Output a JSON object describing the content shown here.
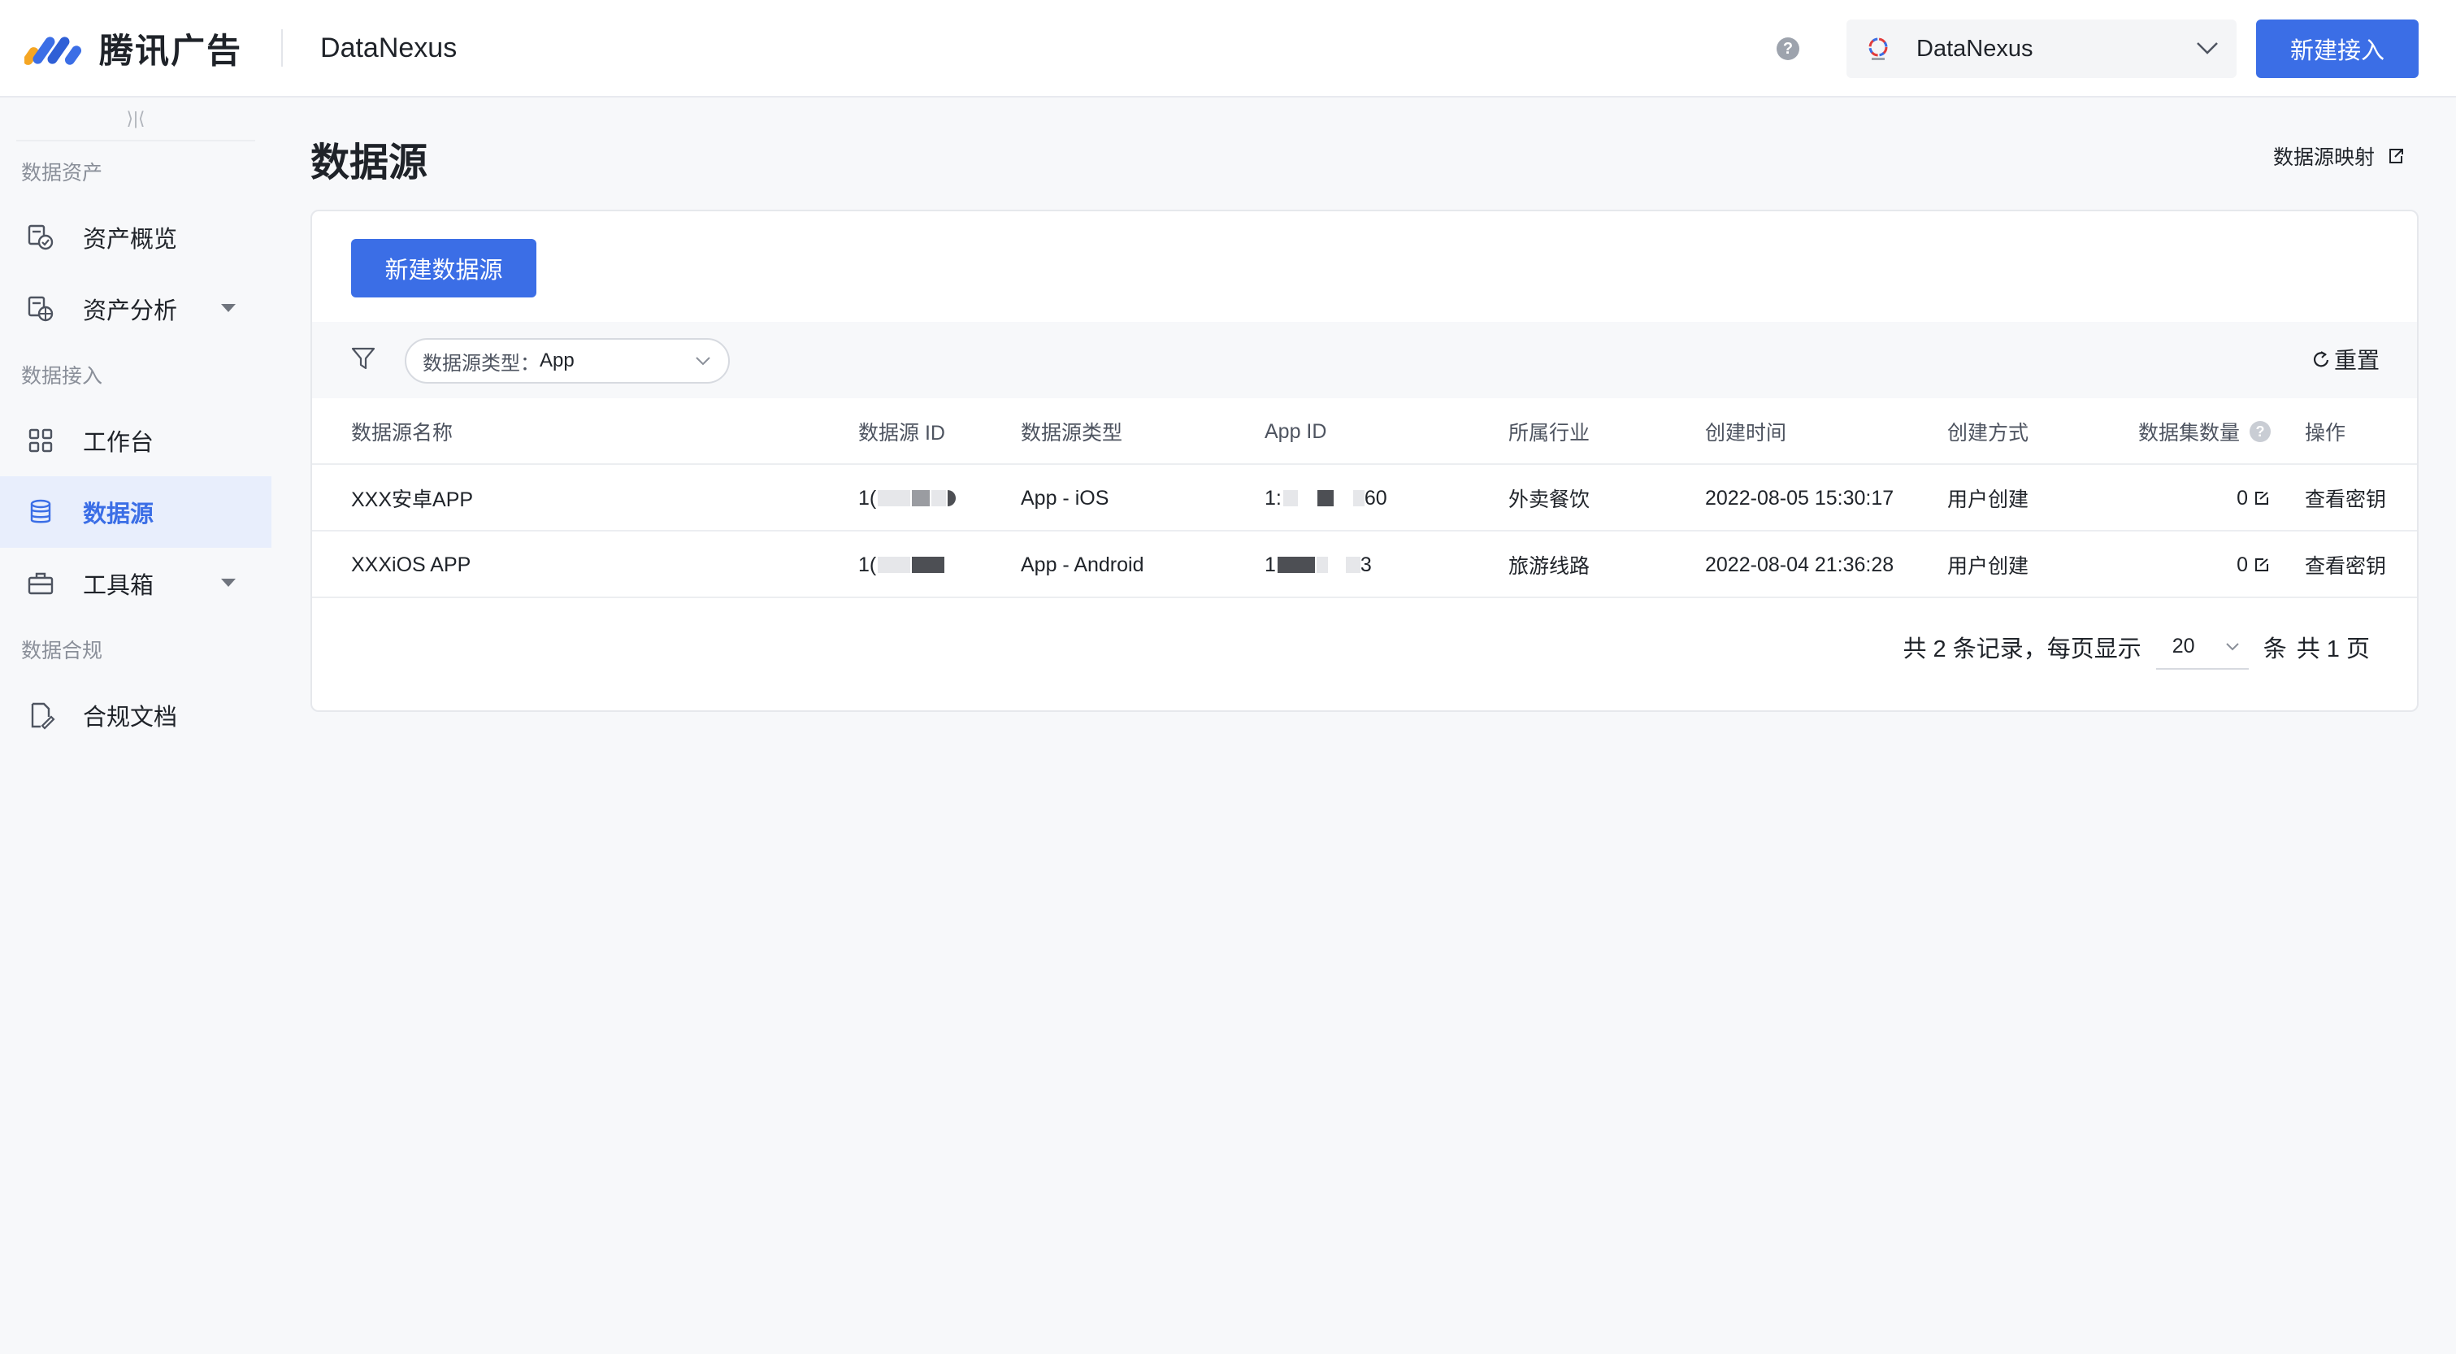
{
  "header": {
    "brand": "腾讯广告",
    "product": "DataNexus",
    "help_icon": "?",
    "account": "DataNexus",
    "new_access_label": "新建接入"
  },
  "sidebar": {
    "collapse_glyph": "⟩|⟨",
    "groups": [
      {
        "title": "数据资产"
      },
      {
        "title": "数据接入"
      },
      {
        "title": "数据合规"
      }
    ],
    "items": [
      {
        "label": "资产概览",
        "icon": "overview-icon"
      },
      {
        "label": "资产分析",
        "icon": "analysis-icon",
        "expandable": true
      },
      {
        "label": "工作台",
        "icon": "grid-icon"
      },
      {
        "label": "数据源",
        "icon": "database-icon",
        "active": true
      },
      {
        "label": "工具箱",
        "icon": "toolbox-icon",
        "expandable": true
      },
      {
        "label": "合规文档",
        "icon": "document-icon"
      }
    ]
  },
  "main": {
    "title": "数据源",
    "mapping_link": "数据源映射",
    "new_datasource_label": "新建数据源",
    "filter": {
      "label": "数据源类型：",
      "value": "App"
    },
    "reset_label": "重置",
    "table": {
      "columns": [
        "数据源名称",
        "数据源 ID",
        "数据源类型",
        "App ID",
        "所属行业",
        "创建时间",
        "创建方式",
        "数据集数量",
        "操作"
      ],
      "rows": [
        {
          "name": "XXX安卓APP",
          "id_prefix": "1(",
          "type": "App - iOS",
          "app_id_prefix": "1:",
          "app_id_suffix": "60",
          "industry": "外卖餐饮",
          "created": "2022-08-05 15:30:17",
          "method": "用户创建",
          "datasets": "0",
          "action": "查看密钥"
        },
        {
          "name": "XXXiOS APP",
          "id_prefix": "1(",
          "type": "App - Android",
          "app_id_prefix": "1",
          "app_id_suffix": "3",
          "industry": "旅游线路",
          "created": "2022-08-04 21:36:28",
          "method": "用户创建",
          "datasets": "0",
          "action": "查看密钥"
        }
      ]
    },
    "pagination": {
      "total_text": "共 2 条记录，每页显示",
      "page_size": "20",
      "unit": "条",
      "pages_text": "共 1 页"
    }
  },
  "colors": {
    "accent": "#3b6ee6",
    "active_bg": "#e8eefc",
    "page_bg": "#f7f8fa"
  }
}
